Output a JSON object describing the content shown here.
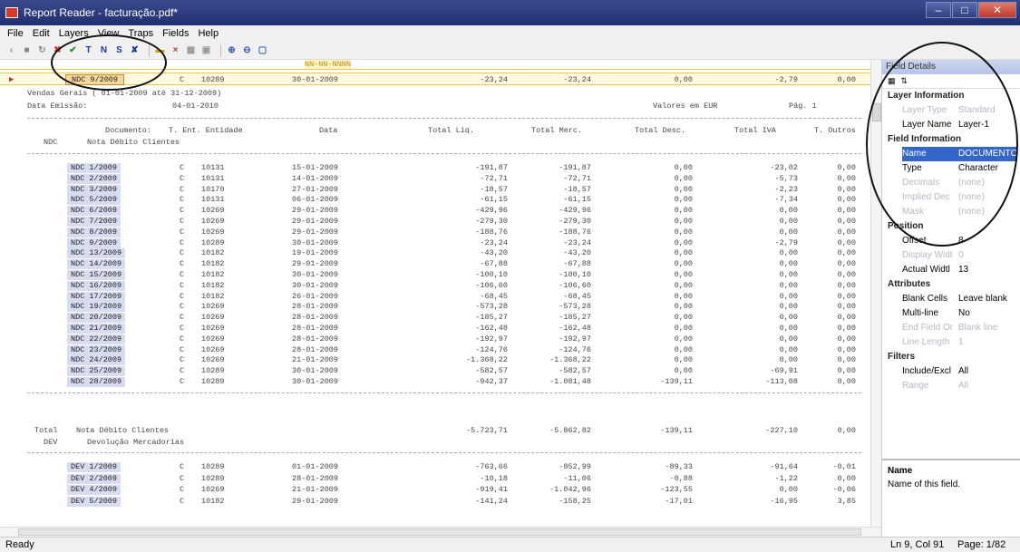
{
  "window": {
    "title": "Report Reader - facturação.pdf*"
  },
  "menu": [
    "File",
    "Edit",
    "Layers",
    "View",
    "Traps",
    "Fields",
    "Help"
  ],
  "toolbar": {
    "icons": [
      "back-icon",
      "save-icon",
      "refresh-icon",
      "delete-icon",
      "check-icon",
      "trap-t-icon",
      "trap-n-icon",
      "trap-s-icon",
      "trap-x-icon",
      "field-icon",
      "field-delete-icon",
      "grid-icon",
      "layout-icon",
      "zoom-in-icon",
      "zoom-out-icon",
      "fit-icon"
    ],
    "letters": {
      "t": "T",
      "n": "N",
      "s": "S"
    }
  },
  "document": {
    "mask": "NN-NN-NNNN",
    "current": {
      "doc": "NDC 9/2009",
      "type": "C",
      "ent": "10289",
      "date": "30-01-2009",
      "liq": "-23,24",
      "merc": "-23,24",
      "desc": "0,00",
      "iva": "-2,79",
      "outros": "0,00"
    },
    "header": {
      "line1": "Vendas Gerais ( 01-01-2009 até 31-12-2009)",
      "line2_label": "Data Emissão:",
      "line2_date": "04-01-2010",
      "currency": "Valores em EUR",
      "page": "Pág. 1"
    },
    "columns": [
      "Documento:",
      "T. Ent. Entidade",
      "Data",
      "Total Liq.",
      "Total Merc.",
      "Total Desc.",
      "Total IVA",
      "T. Outros"
    ],
    "group1": {
      "code": "NDC",
      "name": "Nota Débito Clientes"
    },
    "rows1": [
      [
        "NDC 1/2009",
        "C",
        "10131",
        "15-01-2009",
        "-191,87",
        "-191,87",
        "0,00",
        "-23,02",
        "0,00"
      ],
      [
        "NDC 2/2009",
        "C",
        "10131",
        "14-01-2009",
        "-72,71",
        "-72,71",
        "0,00",
        "-5,73",
        "0,00"
      ],
      [
        "NDC 3/2009",
        "C",
        "10170",
        "27-01-2009",
        "-18,57",
        "-18,57",
        "0,00",
        "-2,23",
        "0,00"
      ],
      [
        "NDC 5/2009",
        "C",
        "10131",
        "06-01-2009",
        "-61,15",
        "-61,15",
        "0,00",
        "-7,34",
        "0,00"
      ],
      [
        "NDC 6/2009",
        "C",
        "10269",
        "29-01-2009",
        "-429,96",
        "-429,96",
        "0,00",
        "0,00",
        "0,00"
      ],
      [
        "NDC 7/2009",
        "C",
        "10269",
        "29-01-2009",
        "-279,30",
        "-279,30",
        "0,00",
        "0,00",
        "0,00"
      ],
      [
        "NDC 8/2009",
        "C",
        "10269",
        "29-01-2009",
        "-188,76",
        "-188,76",
        "0,00",
        "0,00",
        "0,00"
      ],
      [
        "NDC 9/2009",
        "C",
        "10289",
        "30-01-2009",
        "-23,24",
        "-23,24",
        "0,00",
        "-2,79",
        "0,00"
      ],
      [
        "NDC 13/2009",
        "C",
        "10182",
        "19-01-2009",
        "-43,20",
        "-43,20",
        "0,00",
        "0,00",
        "0,00"
      ],
      [
        "NDC 14/2009",
        "C",
        "10182",
        "29-01-2009",
        "-67,88",
        "-67,88",
        "0,00",
        "0,00",
        "0,00"
      ],
      [
        "NDC 15/2009",
        "C",
        "10182",
        "30-01-2009",
        "-100,10",
        "-100,10",
        "0,00",
        "0,00",
        "0,00"
      ],
      [
        "NDC 16/2009",
        "C",
        "10182",
        "30-01-2009",
        "-106,60",
        "-106,60",
        "0,00",
        "0,00",
        "0,00"
      ],
      [
        "NDC 17/2009",
        "C",
        "10182",
        "26-01-2009",
        "-68,45",
        "-68,45",
        "0,00",
        "0,00",
        "0,00"
      ],
      [
        "NDC 19/2009",
        "C",
        "10269",
        "28-01-2009",
        "-573,28",
        "-573,28",
        "0,00",
        "0,00",
        "0,00"
      ],
      [
        "NDC 20/2009",
        "C",
        "10269",
        "28-01-2009",
        "-185,27",
        "-185,27",
        "0,00",
        "0,00",
        "0,00"
      ],
      [
        "NDC 21/2009",
        "C",
        "10269",
        "28-01-2009",
        "-162,48",
        "-162,48",
        "0,00",
        "0,00",
        "0,00"
      ],
      [
        "NDC 22/2009",
        "C",
        "10269",
        "28-01-2009",
        "-192,97",
        "-192,97",
        "0,00",
        "0,00",
        "0,00"
      ],
      [
        "NDC 23/2009",
        "C",
        "10269",
        "28-01-2009",
        "-124,76",
        "-124,76",
        "0,00",
        "0,00",
        "0,00"
      ],
      [
        "NDC 24/2009",
        "C",
        "10269",
        "21-01-2009",
        "-1.368,22",
        "-1.368,22",
        "0,00",
        "0,00",
        "0,00"
      ],
      [
        "NDC 25/2009",
        "C",
        "10289",
        "30-01-2009",
        "-582,57",
        "-582,57",
        "0,00",
        "-69,91",
        "0,00"
      ],
      [
        "NDC 28/2009",
        "C",
        "10289",
        "30-01-2009",
        "-942,37",
        "-1.081,48",
        "-139,11",
        "-113,08",
        "0,00"
      ]
    ],
    "total1": {
      "label": "Total",
      "name": "Nota Débito Clientes",
      "liq": "-5.723,71",
      "merc": "-5.862,82",
      "desc": "-139,11",
      "iva": "-227,10",
      "outros": "0,00"
    },
    "group2": {
      "code": "DEV",
      "name": "Devolução Mercadorias"
    },
    "rows2": [
      [
        "DEV 1/2009",
        "C",
        "10289",
        "01-01-2009",
        "-763,66",
        "-852,99",
        "-89,33",
        "-91,64",
        "-0,01"
      ],
      [
        "DEV 2/2009",
        "C",
        "10289",
        "28-01-2009",
        "-10,18",
        "-11,06",
        "-0,88",
        "-1,22",
        "0,00"
      ],
      [
        "DEV 4/2009",
        "C",
        "10269",
        "21-01-2009",
        "-919,41",
        "-1.042,96",
        "-123,55",
        "0,00",
        "-0,06"
      ],
      [
        "DEV 5/2009",
        "C",
        "10182",
        "29-01-2009",
        "-141,24",
        "-158,25",
        "-17,01",
        "-16,95",
        "3,85"
      ]
    ]
  },
  "panel": {
    "title": "Field Details",
    "sections": {
      "layer": "Layer Information",
      "field": "Field Information",
      "position": "Position",
      "attributes": "Attributes",
      "filters": "Filters"
    },
    "props": {
      "layer_type": [
        "Layer Type",
        "Standard"
      ],
      "layer_name": [
        "Layer Name",
        "Layer-1"
      ],
      "name": [
        "Name",
        "DOCUMENTO"
      ],
      "type": [
        "Type",
        "Character"
      ],
      "decimals": [
        "Decimals",
        "(none)"
      ],
      "implied": [
        "Implied Dec",
        "(none)"
      ],
      "mask": [
        "Mask",
        "(none)"
      ],
      "offset": [
        "Offset",
        "8"
      ],
      "display": [
        "Display Widt",
        "0"
      ],
      "actual": [
        "Actual Widtl",
        "13"
      ],
      "blank": [
        "Blank Cells",
        "Leave blank"
      ],
      "multiline": [
        "Multi-line",
        "No"
      ],
      "endfield": [
        "End Field Or",
        "Blank line"
      ],
      "linelen": [
        "Line Length",
        "1"
      ],
      "include": [
        "Include/Excl",
        "All"
      ],
      "range": [
        "Range",
        "All"
      ]
    },
    "desc_title": "Name",
    "desc_text": "Name of this field."
  },
  "status": {
    "left": "Ready",
    "pos": "Ln 9, Col 91",
    "page": "Page: 1/82"
  },
  "colors": {
    "highlight": "#d8dcf0",
    "select": "#3465c8",
    "title": "#2a3a7e"
  }
}
